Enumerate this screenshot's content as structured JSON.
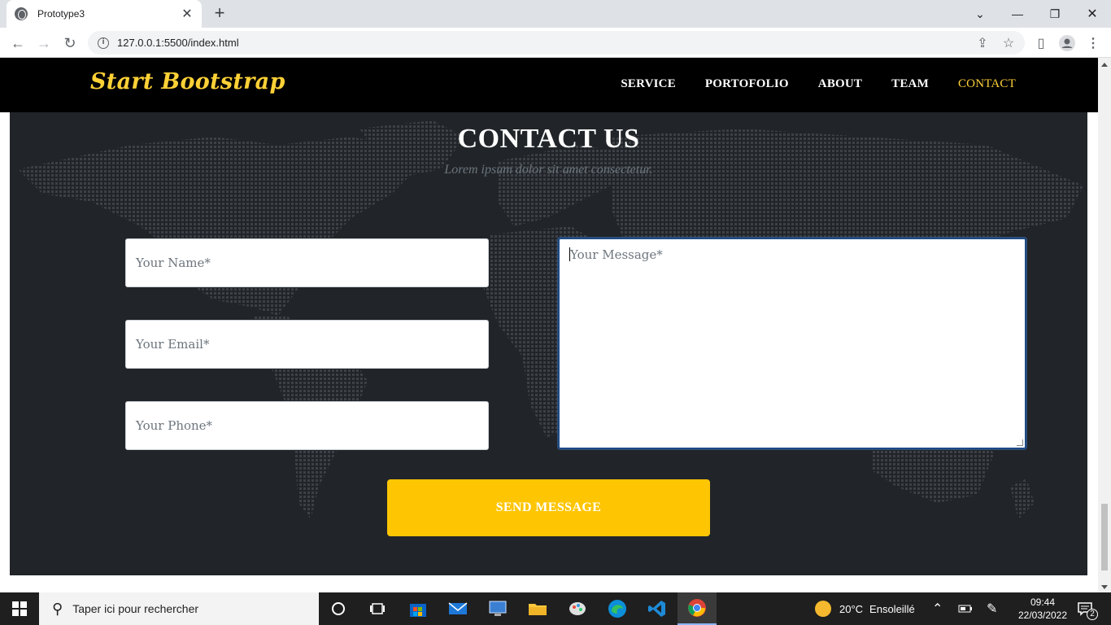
{
  "browser": {
    "tab_title": "Prototype3",
    "url": "127.0.0.1:5500/index.html"
  },
  "site": {
    "brand": "Start Bootstrap",
    "nav": [
      {
        "label": "SERVICE"
      },
      {
        "label": "PORTOFOLIO"
      },
      {
        "label": "ABOUT"
      },
      {
        "label": "TEAM"
      },
      {
        "label": "CONTACT"
      }
    ]
  },
  "contact": {
    "heading": "CONTACT US",
    "subheading": "Lorem ipsum dolor sit amet consectetur.",
    "name_placeholder": "Your Name*",
    "email_placeholder": "Your Email*",
    "phone_placeholder": "Your Phone*",
    "message_placeholder": "Your Message*",
    "submit_label": "SEND MESSAGE"
  },
  "taskbar": {
    "search_placeholder": "Taper ici pour rechercher",
    "weather_temp": "20°C",
    "weather_desc": "Ensoleillé",
    "time": "09:44",
    "date": "22/03/2022",
    "notification_count": "2"
  },
  "colors": {
    "accent": "#fed136",
    "button": "#fec503",
    "section_bg": "#212529",
    "navbar_bg": "#000000"
  }
}
